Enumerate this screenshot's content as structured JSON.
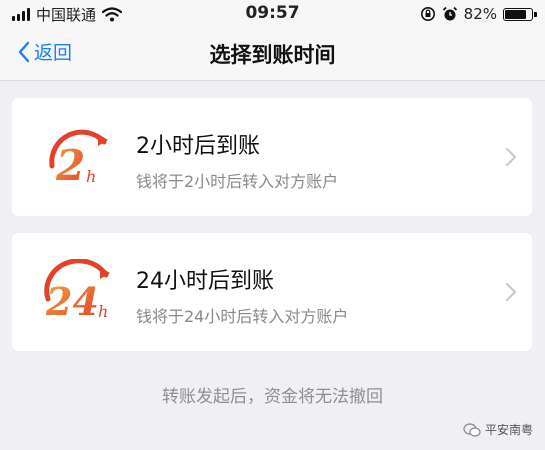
{
  "statusbar": {
    "carrier": "中国联通",
    "time": "09:57",
    "battery": "82%",
    "battery_level": 0.82,
    "icons": [
      "signal-icon",
      "wifi-icon",
      "lock-rotation-icon",
      "alarm-icon",
      "battery-icon"
    ]
  },
  "nav": {
    "back_label": "返回",
    "title": "选择到账时间"
  },
  "options": [
    {
      "logo_text": "2",
      "title": "2小时后到账",
      "subtitle": "钱将于2小时后转入对方账户"
    },
    {
      "logo_text": "24",
      "title": "24小时后到账",
      "subtitle": "钱将于24小时后转入对方账户"
    }
  ],
  "logo_suffix": "h",
  "footer_note": "转账发起后，资金将无法撤回",
  "watermark": "平安南粤",
  "colors": {
    "accent": "#1e7ef5",
    "logo_orange": "#f07a2a",
    "logo_red": "#e2412a",
    "background": "#efeff4"
  }
}
